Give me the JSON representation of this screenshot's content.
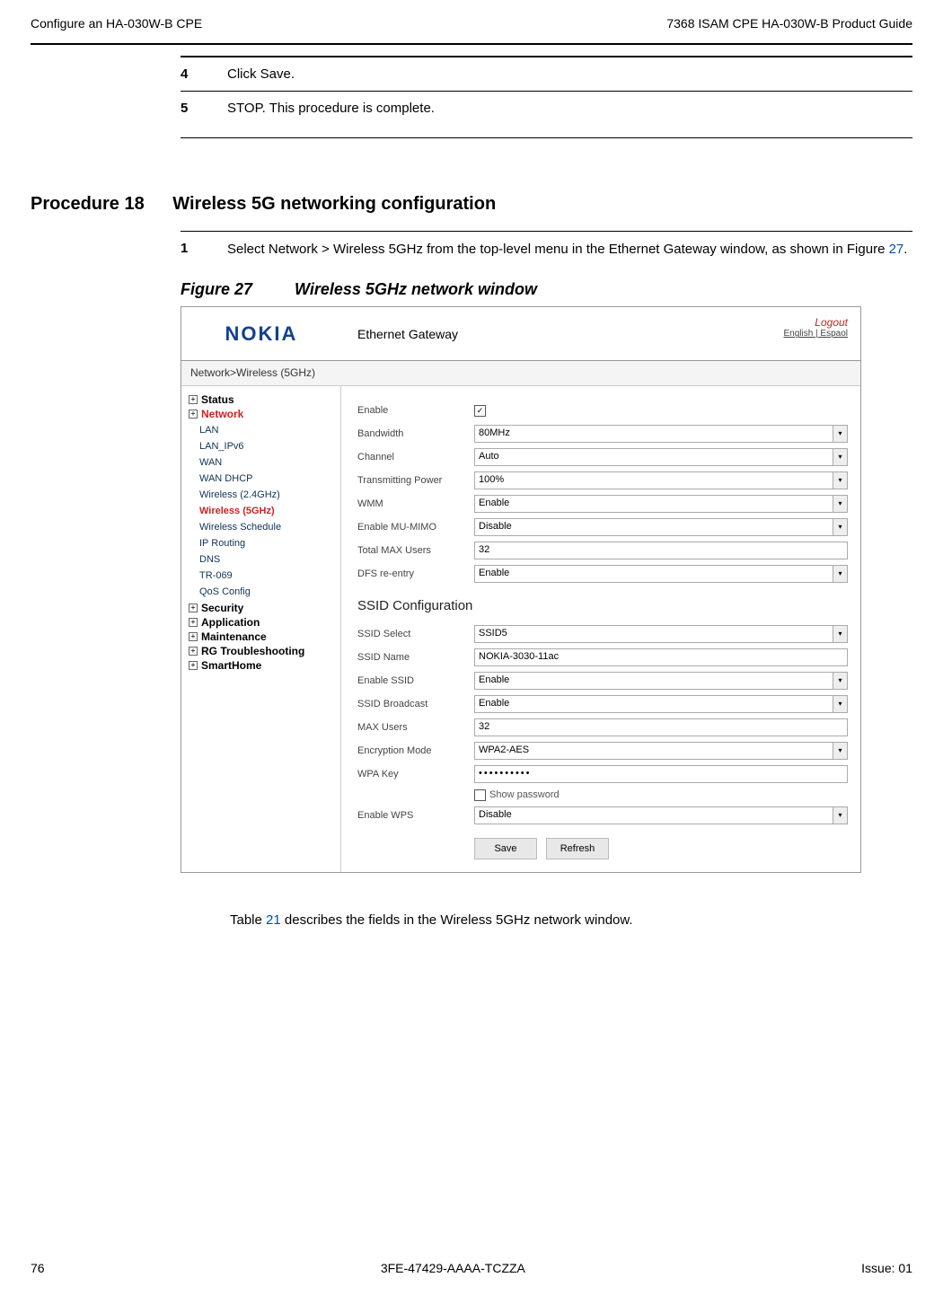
{
  "header": {
    "left": "Configure an HA-030W-B CPE",
    "right": "7368 ISAM CPE HA-030W-B Product Guide"
  },
  "steps45": {
    "s4num": "4",
    "s4": "Click Save.",
    "s5num": "5",
    "s5": "STOP. This procedure is complete."
  },
  "proc": {
    "num": "Procedure 18",
    "title": "Wireless 5G networking configuration"
  },
  "step1": {
    "num": "1",
    "text_a": "Select Network > Wireless 5GHz from the top-level menu in the Ethernet Gateway window, as shown in Figure ",
    "link": "27",
    "text_b": "."
  },
  "figure": {
    "num": "Figure 27",
    "title": "Wireless 5GHz network window"
  },
  "shot": {
    "logo": "NOKIA",
    "eth": "Ethernet Gateway",
    "logout": "Logout",
    "langs": "English | Espaol",
    "crumb": "Network>Wireless (5GHz)",
    "sidebar": {
      "status": "Status",
      "network": "Network",
      "items": [
        "LAN",
        "LAN_IPv6",
        "WAN",
        "WAN DHCP",
        "Wireless (2.4GHz)",
        "Wireless (5GHz)",
        "Wireless Schedule",
        "IP Routing",
        "DNS",
        "TR-069",
        "QoS Config"
      ],
      "active_index": 5,
      "tops": [
        "Security",
        "Application",
        "Maintenance",
        "RG Troubleshooting",
        "SmartHome"
      ]
    },
    "fields": {
      "enable": "Enable",
      "bandwidth": {
        "label": "Bandwidth",
        "value": "80MHz"
      },
      "channel": {
        "label": "Channel",
        "value": "Auto"
      },
      "txpower": {
        "label": "Transmitting Power",
        "value": "100%"
      },
      "wmm": {
        "label": "WMM",
        "value": "Enable"
      },
      "mumimo": {
        "label": "Enable MU-MIMO",
        "value": "Disable"
      },
      "maxusers": {
        "label": "Total MAX Users",
        "value": "32"
      },
      "dfs": {
        "label": "DFS re-entry",
        "value": "Enable"
      }
    },
    "ssid_h": "SSID Configuration",
    "ssid": {
      "select": {
        "label": "SSID Select",
        "value": "SSID5"
      },
      "name": {
        "label": "SSID Name",
        "value": "NOKIA-3030-11ac"
      },
      "enable": {
        "label": "Enable SSID",
        "value": "Enable"
      },
      "broadcast": {
        "label": "SSID Broadcast",
        "value": "Enable"
      },
      "max": {
        "label": "MAX Users",
        "value": "32"
      },
      "enc": {
        "label": "Encryption Mode",
        "value": "WPA2-AES"
      },
      "wpakey": {
        "label": "WPA Key",
        "value": "••••••••••"
      },
      "showpw": "Show password",
      "wps": {
        "label": "Enable WPS",
        "value": "Disable"
      }
    },
    "buttons": {
      "save": "Save",
      "refresh": "Refresh"
    }
  },
  "caption": {
    "pre": "Table ",
    "link": "21",
    "post": " describes the fields in the Wireless 5GHz network window."
  },
  "footer": {
    "page": "76",
    "doc": "3FE-47429-AAAA-TCZZA",
    "issue": "Issue: 01"
  }
}
